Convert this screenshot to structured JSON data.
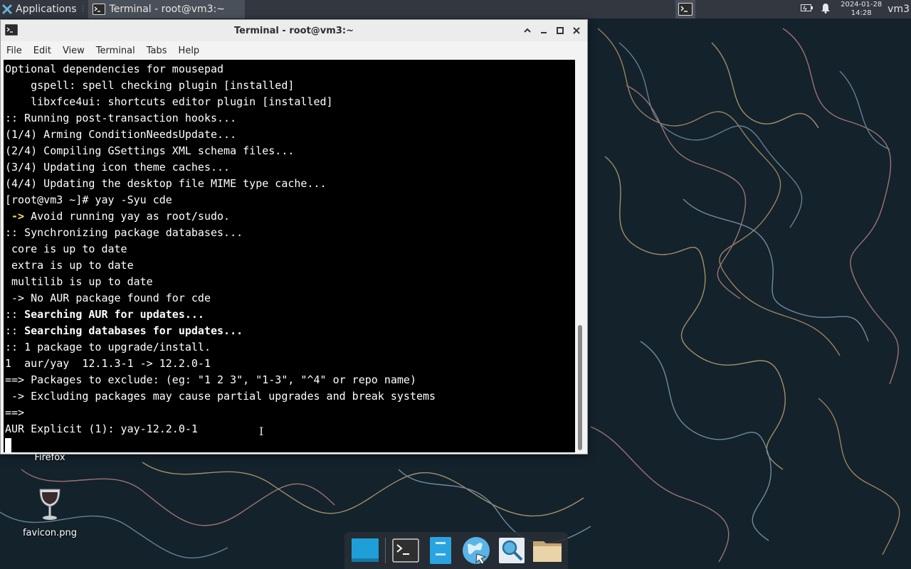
{
  "top_panel": {
    "applications_label": "Applications",
    "task_title": "Terminal - root@vm3:~",
    "clock_date": "2024-01-28",
    "clock_time": "14:28",
    "user": "vm3"
  },
  "window": {
    "title": "Terminal - root@vm3:~",
    "menu": [
      "File",
      "Edit",
      "View",
      "Terminal",
      "Tabs",
      "Help"
    ]
  },
  "terminal": {
    "lines": [
      {
        "text": "Optional dependencies for mousepad",
        "style": "normal"
      },
      {
        "text": "    gspell: spell checking plugin [installed]",
        "style": "normal"
      },
      {
        "text": "    libxfce4ui: shortcuts editor plugin [installed]",
        "style": "normal"
      },
      {
        "text": ":: Running post-transaction hooks...",
        "style": "normal"
      },
      {
        "text": "(1/4) Arming ConditionNeedsUpdate...",
        "style": "normal"
      },
      {
        "text": "(2/4) Compiling GSettings XML schema files...",
        "style": "normal"
      },
      {
        "text": "(3/4) Updating icon theme caches...",
        "style": "normal"
      },
      {
        "text": "(4/4) Updating the desktop file MIME type cache...",
        "style": "normal"
      },
      {
        "text": "[root@vm3 ~]# yay -Syu cde",
        "style": "normal"
      },
      {
        "prefix": " -> ",
        "text": "Avoid running yay as root/sudo.",
        "style": "warn"
      },
      {
        "text": ":: Synchronizing package databases...",
        "style": "normal"
      },
      {
        "text": " core is up to date",
        "style": "normal"
      },
      {
        "text": " extra is up to date",
        "style": "normal"
      },
      {
        "text": " multilib is up to date",
        "style": "normal"
      },
      {
        "text": " -> No AUR package found for cde",
        "style": "normal"
      },
      {
        "prefix": ":: ",
        "text": "Searching AUR for updates...",
        "style": "bold"
      },
      {
        "prefix": ":: ",
        "text": "Searching databases for updates...",
        "style": "bold"
      },
      {
        "text": ":: 1 package to upgrade/install.",
        "style": "normal"
      },
      {
        "text": "1  aur/yay  12.1.3-1 -> 12.2.0-1",
        "style": "normal"
      },
      {
        "text": "==> Packages to exclude: (eg: \"1 2 3\", \"1-3\", \"^4\" or repo name)",
        "style": "normal"
      },
      {
        "text": " -> Excluding packages may cause partial upgrades and break systems",
        "style": "normal"
      },
      {
        "text": "==> ",
        "style": "normal"
      },
      {
        "text": "AUR Explicit (1): yay-12.2.0-1",
        "style": "normal"
      }
    ]
  },
  "desktop": {
    "firefox_label": "Firefox",
    "favicon_label": "favicon.png"
  },
  "dock": {
    "items": [
      "show-desktop",
      "terminal",
      "file-manager",
      "web-browser",
      "app-finder",
      "home-folder"
    ]
  }
}
